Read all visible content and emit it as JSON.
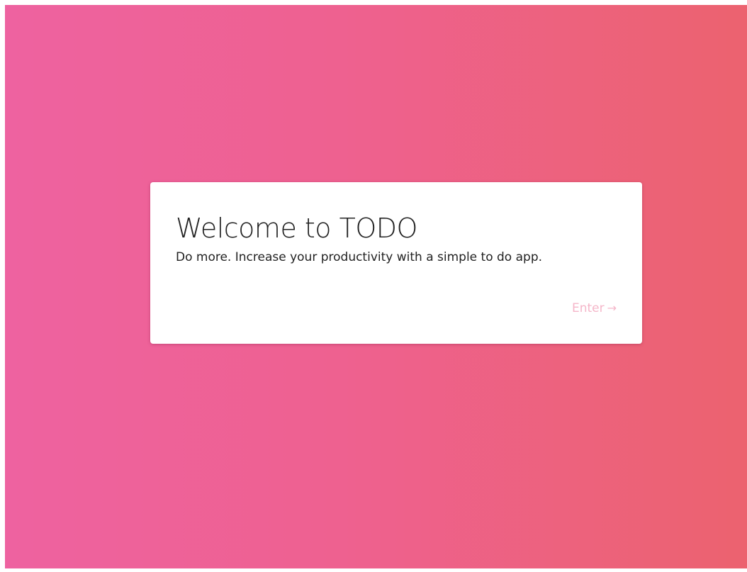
{
  "page": {
    "background_colors": [
      "#ee62a0",
      "#ec626f"
    ]
  },
  "welcome_card": {
    "title": "Welcome to TODO",
    "subtitle": "Do more. Increase your productivity with a simple to do app.",
    "enter_label": "Enter",
    "enter_icon": "arrow-right-icon",
    "enter_icon_glyph": "→",
    "enter_color": "#f5b6c9"
  }
}
